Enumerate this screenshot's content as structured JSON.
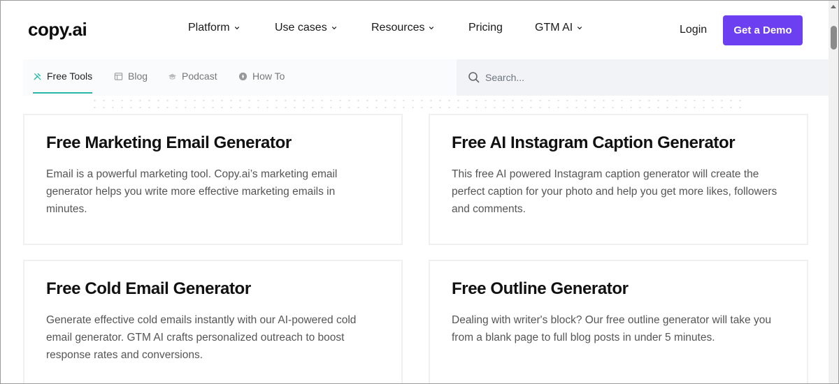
{
  "header": {
    "logo": "copy.ai",
    "nav": [
      {
        "label": "Platform",
        "has_dropdown": true
      },
      {
        "label": "Use cases",
        "has_dropdown": true
      },
      {
        "label": "Resources",
        "has_dropdown": true
      },
      {
        "label": "Pricing",
        "has_dropdown": false
      },
      {
        "label": "GTM AI",
        "has_dropdown": true
      }
    ],
    "login": "Login",
    "cta": "Get a Demo"
  },
  "subnav": {
    "tabs": [
      {
        "label": "Free Tools",
        "icon": "tools-icon",
        "active": true
      },
      {
        "label": "Blog",
        "icon": "blog-icon",
        "active": false
      },
      {
        "label": "Podcast",
        "icon": "podcast-icon",
        "active": false
      },
      {
        "label": "How To",
        "icon": "how-to-icon",
        "active": false
      }
    ],
    "search_placeholder": "Search..."
  },
  "cards": [
    {
      "title": "Free Marketing Email Generator",
      "description": "Email is a powerful marketing tool. Copy.ai’s marketing email generator helps you write more effective marketing emails in minutes."
    },
    {
      "title": "Free AI Instagram Caption Generator",
      "description": "This free AI powered Instagram caption generator will create the perfect caption for your photo and help you get more likes, followers and comments."
    },
    {
      "title": "Free Cold Email Generator",
      "description": "Generate effective cold emails instantly with our AI-powered cold email generator. GTM AI crafts personalized outreach to boost response rates and conversions."
    },
    {
      "title": "Free Outline Generator",
      "description": "Dealing with writer's block? Our free outline generator will take you from a blank page to full blog posts in under 5 minutes."
    }
  ],
  "colors": {
    "accent": "#6c3ff0",
    "tab_underline": "#27b8a6",
    "search_bg": "#f1f3f6"
  }
}
